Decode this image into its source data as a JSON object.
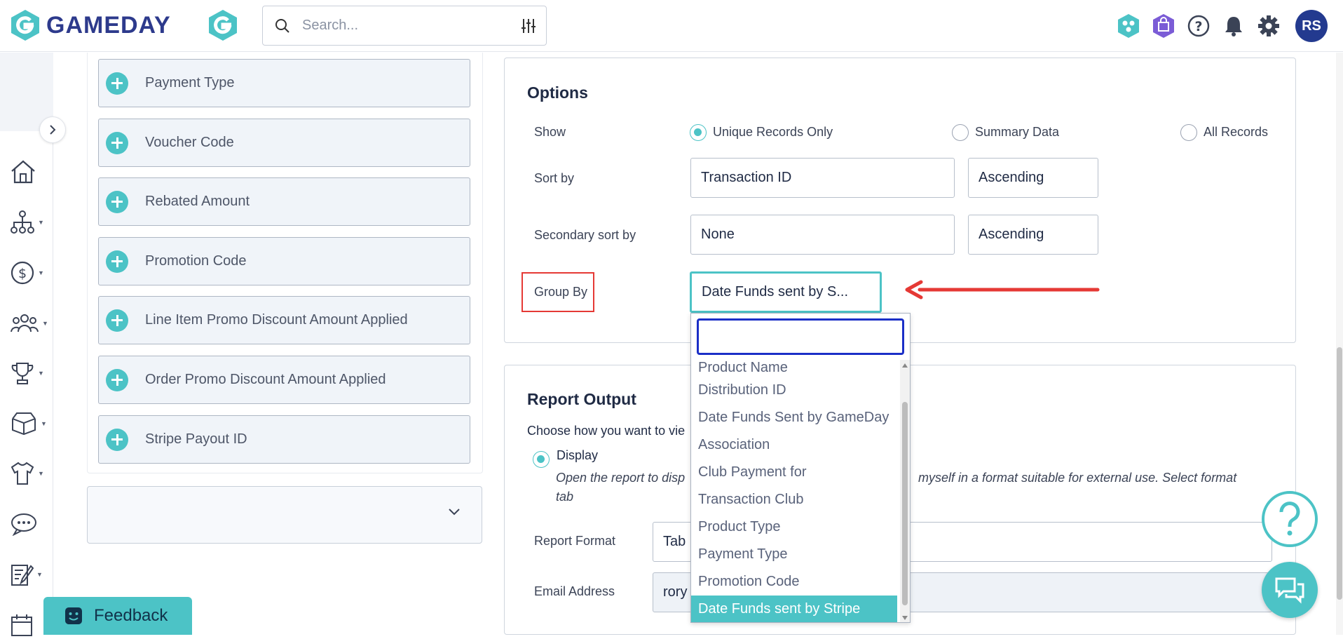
{
  "header": {
    "logo_text": "GAMEDAY",
    "search_placeholder": "Search...",
    "avatar_initials": "RS"
  },
  "fields": [
    {
      "label": "Payment Type"
    },
    {
      "label": "Voucher Code"
    },
    {
      "label": "Rebated Amount"
    },
    {
      "label": "Promotion Code"
    },
    {
      "label": "Line Item Promo Discount Amount Applied"
    },
    {
      "label": "Order Promo Discount Amount Applied"
    },
    {
      "label": "Stripe Payout ID"
    }
  ],
  "options": {
    "title": "Options",
    "show_label": "Show",
    "show_choices": [
      "Unique Records Only",
      "Summary Data",
      "All Records"
    ],
    "show_selected": "Unique Records Only",
    "sort_by_label": "Sort by",
    "sort_by_value": "Transaction ID",
    "sort_by_order": "Ascending",
    "secondary_sort_label": "Secondary sort by",
    "secondary_sort_value": "None",
    "secondary_sort_order": "Ascending",
    "group_by_label": "Group By",
    "group_by_value": "Date Funds sent by S..."
  },
  "group_by_dropdown": {
    "search_value": "",
    "options": [
      "Product Name",
      "Distribution ID",
      "Date Funds Sent by GameDay",
      "Association",
      "Club Payment for",
      "Transaction Club",
      "Product Type",
      "Payment Type",
      "Promotion Code",
      "Date Funds sent by Stripe"
    ],
    "selected": "Date Funds sent by Stripe"
  },
  "report_output": {
    "title": "Report Output",
    "intro": "Choose how you want to vie",
    "display_label": "Display",
    "display_desc_left": "Open the report to disp",
    "display_desc_right": "myself in a format suitable for external use. Select format",
    "display_desc_line2": "tab",
    "format_label": "Report Format",
    "format_value": "Tab",
    "email_label": "Email Address",
    "email_value": "rory"
  },
  "feedback_label": "Feedback",
  "colors": {
    "accent": "#4cc3c6",
    "brand": "#2d3a8c",
    "highlight_red": "#e53935",
    "focus_blue": "#1b2fc7"
  }
}
